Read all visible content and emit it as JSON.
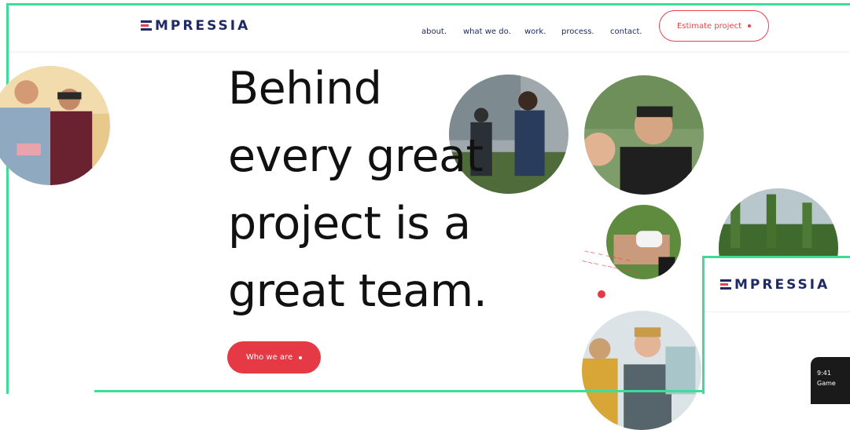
{
  "brand": {
    "name": "MPRESSIA",
    "accent": "#e8414f",
    "navy": "#1e2a63",
    "frame": "#3ddc97"
  },
  "nav": {
    "items": [
      "about.",
      "what we do.",
      "work.",
      "process.",
      "contact."
    ]
  },
  "header": {
    "cta_label": "Estimate project"
  },
  "hero": {
    "lines": [
      "Behind",
      "every great",
      "project is a",
      "great team."
    ],
    "button_label": "Who we are"
  },
  "overlay": {
    "logo": "MPRESSIA",
    "phone_time": "9:41",
    "phone_text": "Game"
  }
}
